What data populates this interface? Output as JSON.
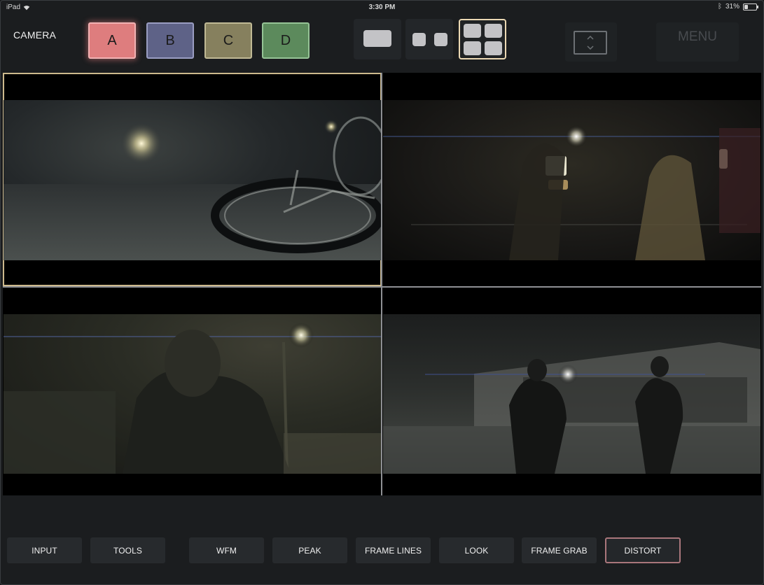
{
  "status_bar": {
    "device": "iPad",
    "time": "3:30 PM",
    "battery": "31%",
    "battery_level": 0.31
  },
  "header": {
    "camera_label": "CAMERA",
    "cameras": [
      {
        "label": "A",
        "color": "#de7d7e",
        "selected": true
      },
      {
        "label": "B",
        "color": "#5e6287",
        "selected": false
      },
      {
        "label": "C",
        "color": "#86805e",
        "selected": false
      },
      {
        "label": "D",
        "color": "#5c8a5c",
        "selected": false
      }
    ],
    "layouts": [
      {
        "name": "single-view",
        "icon": "single-rect-icon",
        "selected": false
      },
      {
        "name": "dual-view",
        "icon": "two-squares-icon",
        "selected": false
      },
      {
        "name": "quad-view",
        "icon": "four-squares-icon",
        "selected": true
      }
    ],
    "expand_icon": "expand-vertical-icon",
    "menu_label": "MENU"
  },
  "viewer": {
    "selected_cell": 1,
    "cells": [
      "camera-a-feed",
      "camera-b-feed",
      "camera-c-feed",
      "camera-d-feed"
    ]
  },
  "toolbar": {
    "input": "INPUT",
    "tools": "TOOLS",
    "wfm": "WFM",
    "peak": "PEAK",
    "frame_lines": "FRAME LINES",
    "look": "LOOK",
    "frame_grab": "FRAME GRAB",
    "distort": "DISTORT",
    "active": "DISTORT"
  },
  "colors": {
    "selected_outline": "#cdb98d",
    "active_tool_border": "#a9767b",
    "background": "#17191b"
  }
}
